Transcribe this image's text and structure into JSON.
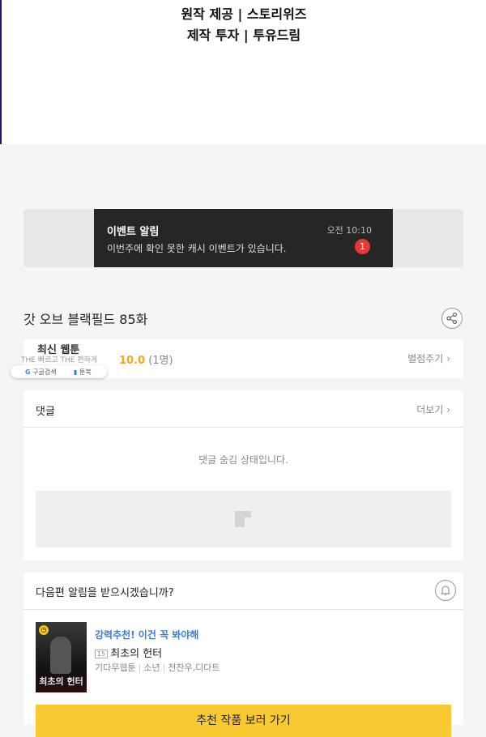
{
  "credits": {
    "line1": "원작 제공 | 스토리위즈",
    "line2": "제작 투자 | 투유드림"
  },
  "toast": {
    "title": "이벤트 알림",
    "message": "이번주에 확인 못한 캐시 이벤트가 있습니다.",
    "time": "오전 10:10",
    "badge": "1"
  },
  "episode": {
    "title": "갓 오브 블랙필드 85화",
    "share_icon": "share-icon"
  },
  "rating": {
    "score": "10.0",
    "count": "(1명)",
    "rate_button": "별점주기"
  },
  "overlay": {
    "label": "최신 웹툰",
    "subtext": "THE 빠르고 THE 편하게",
    "search_label": "구글검색",
    "pin_label": "툰북"
  },
  "comments": {
    "header": "댓글",
    "more": "더보기",
    "hidden_message": "댓글 숨김 상태입니다."
  },
  "notify": {
    "question": "다음편 알림을 받으시겠습니까?",
    "bell_icon": "bell-icon"
  },
  "recommend": {
    "tag": "강력추천! 이건 꼭 봐야해",
    "age": "15",
    "title": "최초의 헌터",
    "cover_text": "최초의 헌터",
    "meta": [
      "기다무웹툰",
      "소년",
      "전찬우,디다트"
    ],
    "button": "추천 작품 보러 가기"
  },
  "colors": {
    "accent_yellow": "#f9c932",
    "score_orange": "#f5a623",
    "link_blue": "#3b7dd8",
    "badge_red": "#e53935",
    "toast_bg": "#262626"
  }
}
